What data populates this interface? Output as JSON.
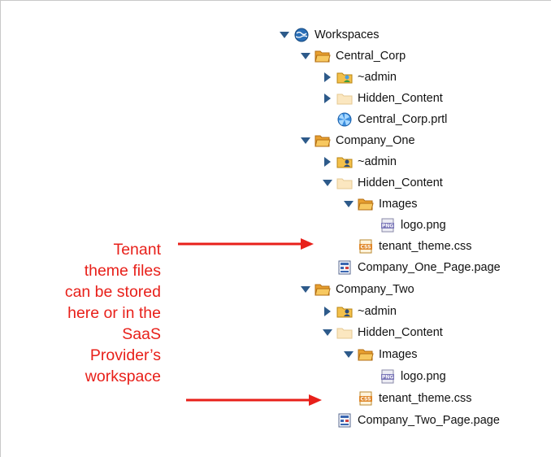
{
  "tree": {
    "workspaces": "Workspaces",
    "central_corp": "Central_Corp",
    "cc_admin": "~admin",
    "cc_hidden": "Hidden_Content",
    "cc_portal": "Central_Corp.prtl",
    "company_one": "Company_One",
    "c1_admin": "~admin",
    "c1_hidden": "Hidden_Content",
    "c1_images": "Images",
    "c1_logo": "logo.png",
    "c1_theme": "tenant_theme.css",
    "c1_page": "Company_One_Page.page",
    "company_two": "Company_Two",
    "c2_admin": "~admin",
    "c2_hidden": "Hidden_Content",
    "c2_images": "Images",
    "c2_logo": "logo.png",
    "c2_theme": "tenant_theme.css",
    "c2_page": "Company_Two_Page.page"
  },
  "annotation": {
    "lines": [
      "Tenant",
      "theme files",
      "can be stored",
      "here or in the",
      "SaaS",
      "Provider’s",
      "workspace"
    ],
    "color": "#e8201a"
  },
  "icon_names": {
    "png": "PNG",
    "css": "CSS"
  }
}
